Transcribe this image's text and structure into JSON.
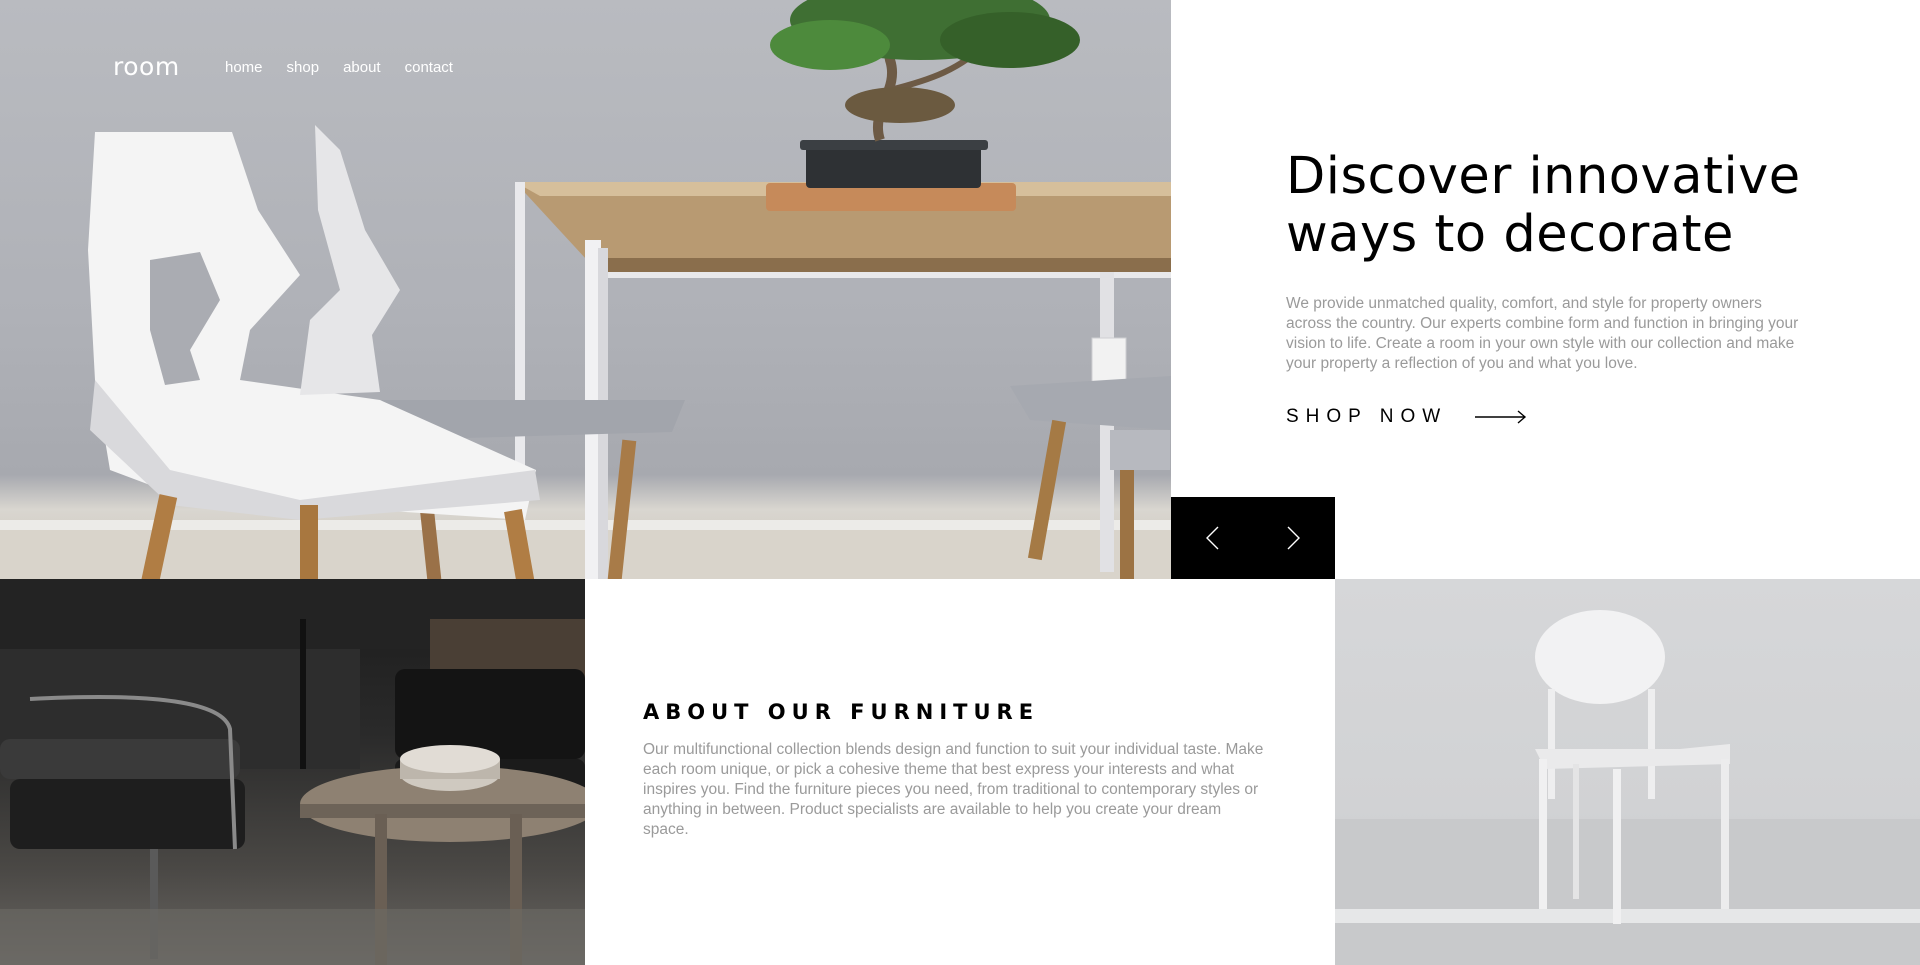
{
  "header": {
    "logo": "room",
    "nav": [
      "home",
      "shop",
      "about",
      "contact"
    ]
  },
  "hero": {
    "title_line1": "Discover innovative",
    "title_line2": "ways to decorate",
    "description": "We provide unmatched quality, comfort, and style for property owners across the country. Our experts combine form and function in bringing your vision to life. Create a room in your own style with our collection and make your property a reflection of you and what you love.",
    "cta_label": "SHOP NOW"
  },
  "slider": {
    "prev_icon": "chevron-left-icon",
    "next_icon": "chevron-right-icon"
  },
  "about": {
    "title": "ABOUT OUR FURNITURE",
    "description": "Our multifunctional collection blends design and function to suit your individual taste. Make each room unique, or pick a cohesive theme that best express your interests and what inspires you. Find the furniture pieces you need, from traditional to contemporary styles or anything in between. Product specialists are available to help you create your dream space."
  },
  "colors": {
    "text_primary": "#000000",
    "text_muted": "#9a9a9a",
    "background": "#ffffff",
    "slider_bg": "#000000"
  }
}
